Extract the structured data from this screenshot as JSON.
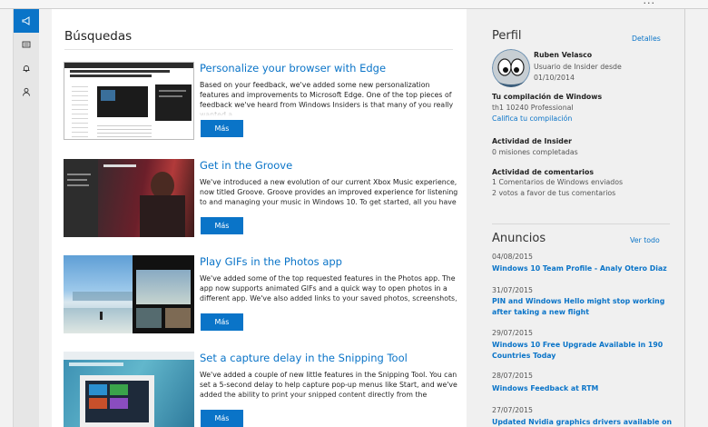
{
  "window": {
    "top_right_glyph": "..."
  },
  "nav": {
    "items": [
      {
        "icon": "megaphone-icon",
        "active": true
      },
      {
        "icon": "news-icon",
        "active": false
      },
      {
        "icon": "bell-icon",
        "active": false
      },
      {
        "icon": "person-icon",
        "active": false
      }
    ]
  },
  "main": {
    "heading": "Búsquedas",
    "cards": [
      {
        "title": "Personalize your browser with Edge",
        "body": "Based on your feedback, we've added some new personalization features and improvements to Microsoft Edge. One of the top pieces of feedback we've heard from Windows Insiders is that many of you really wanted a",
        "button": "Más"
      },
      {
        "title": "Get in the Groove",
        "body": "We've introduced a new evolution of our current Xbox Music experience, now titled Groove. Groove provides an improved experience for listening to and managing your music in Windows 10. To get started, all you have",
        "button": "Más"
      },
      {
        "title": "Play GIFs in the Photos app",
        "body": "We've added some of the top requested features in the Photos app. The app now supports animated GIFs and a quick way to open photos in a different app. We've also added links to your saved photos, screenshots,",
        "button": "Más"
      },
      {
        "title": "Set a capture delay in the Snipping Tool",
        "body": "We've added a couple of new little features in the Snipping Tool. You can set a 5-second delay to help capture pop-up menus like Start, and we've added the ability to print your snipped content directly from the",
        "button": "Más"
      }
    ]
  },
  "profile": {
    "heading": "Perfil",
    "details_link": "Detalles",
    "name": "Ruben Velasco",
    "since_label": "Usuario de Insider desde",
    "since_date": "01/10/2014",
    "build_label": "Tu compilación de Windows",
    "build_value": "th1 10240 Professional",
    "rate_link": "Califica tu compilación",
    "activity_label": "Actividad de Insider",
    "activity_value": "0 misiones completadas",
    "comments_label": "Actividad de comentarios",
    "comments_sent": "1 Comentarios de Windows enviados",
    "comments_votes": "2 votos a favor de tus comentarios"
  },
  "announcements": {
    "heading": "Anuncios",
    "see_all": "Ver todo",
    "items": [
      {
        "date": "04/08/2015",
        "title": "Windows 10 Team Profile - Analy Otero Diaz"
      },
      {
        "date": "31/07/2015",
        "title": "PIN and Windows Hello might stop working after taking a new flight"
      },
      {
        "date": "29/07/2015",
        "title": "Windows 10 Free Upgrade Available in 190 Countries Today"
      },
      {
        "date": "28/07/2015",
        "title": "Windows Feedback at RTM"
      },
      {
        "date": "27/07/2015",
        "title": "Updated Nvidia graphics drivers available on"
      }
    ]
  },
  "colors": {
    "accent": "#0a74c8",
    "sidebar_bg": "#f0f0f0",
    "main_bg": "#ffffff"
  }
}
